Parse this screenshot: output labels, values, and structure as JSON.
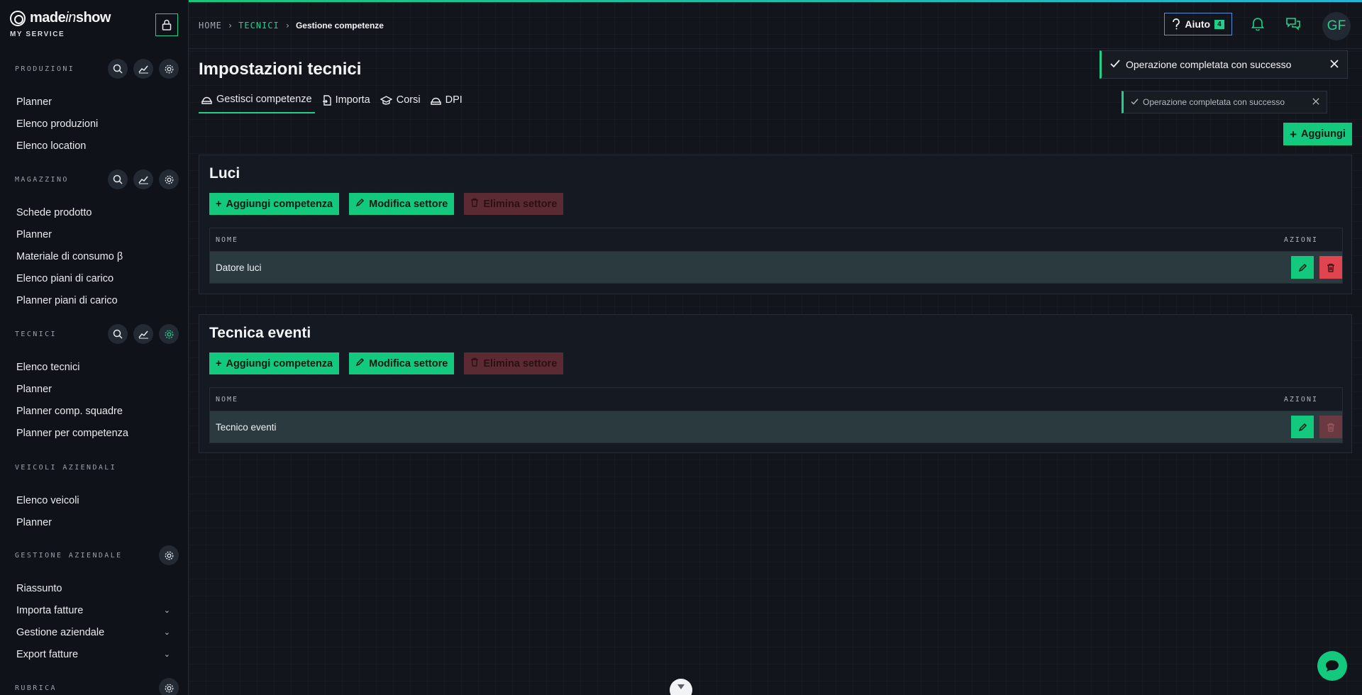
{
  "brand": {
    "name_made": "made",
    "name_in": "in",
    "name_show": "show",
    "subtitle": "MY SERVICE"
  },
  "sidebar": {
    "sections": [
      {
        "title": "PRODUZIONI",
        "items": [
          "Planner",
          "Elenco produzioni",
          "Elenco location"
        ]
      },
      {
        "title": "MAGAZZINO",
        "items": [
          "Schede prodotto",
          "Planner",
          "Materiale di consumo β",
          "Elenco piani di carico",
          "Planner piani di carico"
        ]
      },
      {
        "title": "TECNICI",
        "items": [
          "Elenco tecnici",
          "Planner",
          "Planner comp. squadre",
          "Planner per competenza"
        ]
      },
      {
        "title": "VEICOLI AZIENDALI",
        "items": [
          "Elenco veicoli",
          "Planner"
        ]
      },
      {
        "title": "GESTIONE AZIENDALE",
        "items": [
          "Riassunto",
          "Importa fatture",
          "Gestione aziendale",
          "Export fatture"
        ]
      },
      {
        "title": "RUBRICA"
      }
    ]
  },
  "breadcrumb": {
    "home": "HOME",
    "tecnici": "TECNICI",
    "current": "Gestione competenze"
  },
  "header": {
    "help_label": "Aiuto",
    "help_badge": "4",
    "avatar_initials": "GF"
  },
  "page": {
    "title": "Impostazioni tecnici",
    "tabs": [
      "Gestisci competenze",
      "Importa",
      "Corsi",
      "DPI"
    ],
    "add_label": "Aggiungi"
  },
  "toasts": [
    {
      "text": "Operazione completata con successo"
    },
    {
      "text": "Operazione completata con successo"
    }
  ],
  "labels": {
    "add_competence": "Aggiungi competenza",
    "edit_sector": "Modifica settore",
    "delete_sector": "Elimina settore",
    "col_name": "NOME",
    "col_actions": "AZIONI"
  },
  "sectors": [
    {
      "title": "Luci",
      "rows": [
        "Datore luci"
      ]
    },
    {
      "title": "Tecnica eventi",
      "rows": [
        "Tecnico eventi"
      ]
    }
  ],
  "colors": {
    "accent": "#13c97e",
    "danger": "#e0444e",
    "background": "#12151c"
  }
}
